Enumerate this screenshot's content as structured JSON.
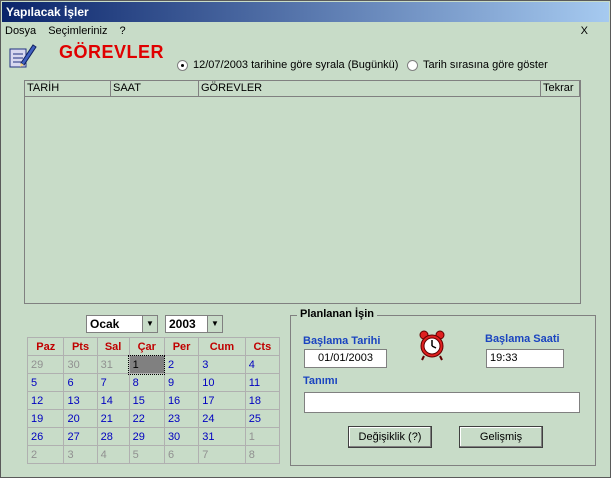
{
  "window": {
    "title": "Yapılacak İşler"
  },
  "menu": {
    "items": [
      "Dosya",
      "Seçimleriniz",
      "?"
    ],
    "close": "X"
  },
  "header": {
    "title": "GÖREVLER"
  },
  "sort_options": [
    {
      "label": "12/07/2003 tarihine göre syrala (Bugünkü)",
      "checked": true
    },
    {
      "label": "Tarih sırasına göre  göster",
      "checked": false
    }
  ],
  "list": {
    "columns": [
      "TARİH",
      "SAAT",
      "GÖREVLER",
      "Tekrar"
    ]
  },
  "calendar": {
    "month": "Ocak",
    "year": "2003",
    "weekdays": [
      "Paz",
      "Pts",
      "Sal",
      "Çar",
      "Per",
      "Cum",
      "Cts"
    ],
    "weeks": [
      [
        "29",
        "30",
        "31",
        "1",
        "2",
        "3",
        "4"
      ],
      [
        "5",
        "6",
        "7",
        "8",
        "9",
        "10",
        "11"
      ],
      [
        "12",
        "13",
        "14",
        "15",
        "16",
        "17",
        "18"
      ],
      [
        "19",
        "20",
        "21",
        "22",
        "23",
        "24",
        "25"
      ],
      [
        "26",
        "27",
        "28",
        "29",
        "30",
        "31",
        "1"
      ],
      [
        "2",
        "3",
        "4",
        "5",
        "6",
        "7",
        "8"
      ]
    ],
    "selected_day": "1"
  },
  "planned": {
    "title": "Planlanan İşin",
    "start_date_label": "Başlama Tarihi",
    "start_date": "01/01/2003",
    "start_time_label": "Başlama Saati",
    "start_time": "19:33",
    "description_label": "Tanımı",
    "description": "",
    "change_button": "Değişiklik (?)",
    "advanced_button": "Gelişmiş"
  }
}
